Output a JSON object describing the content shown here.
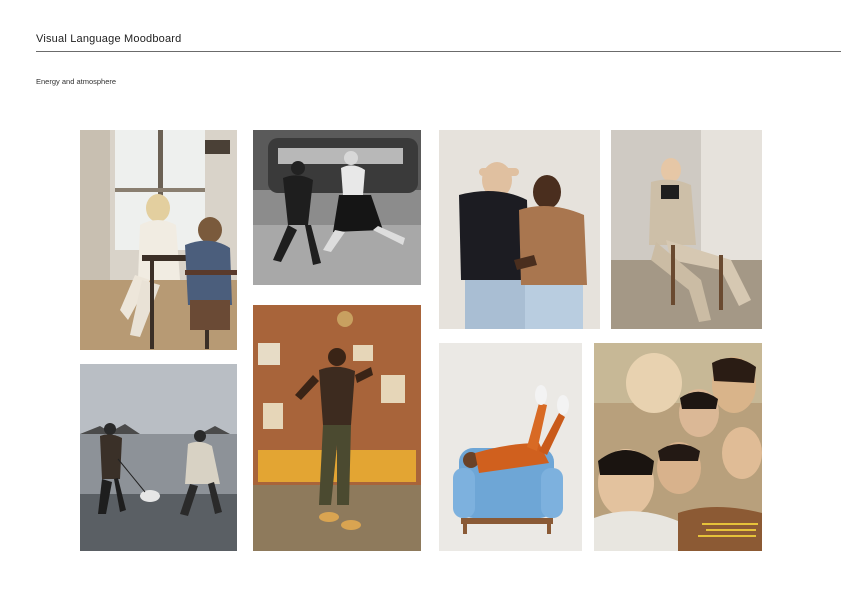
{
  "header": {
    "title": "Visual Language Moodboard",
    "subtitle": "Energy and atmosphere"
  },
  "photos": [
    {
      "name": "photo-woman-window-child",
      "description": "woman in white at kitchen table with child"
    },
    {
      "name": "photo-bw-dancing-couple",
      "description": "black and white couple dancing in street by bus"
    },
    {
      "name": "photo-two-men-laughing",
      "description": "two men laughing against beige wall"
    },
    {
      "name": "photo-woman-chair-suit",
      "description": "woman in beige suit seated on chair"
    },
    {
      "name": "photo-couple-beach-dog",
      "description": "couple walking dog on beach"
    },
    {
      "name": "photo-man-dancing-headphones",
      "description": "man dancing with headphones in retro room"
    },
    {
      "name": "photo-legs-up-armchair",
      "description": "person in orange lying on blue armchair"
    },
    {
      "name": "photo-group-selfie",
      "description": "group of friends hugging close-up"
    }
  ]
}
